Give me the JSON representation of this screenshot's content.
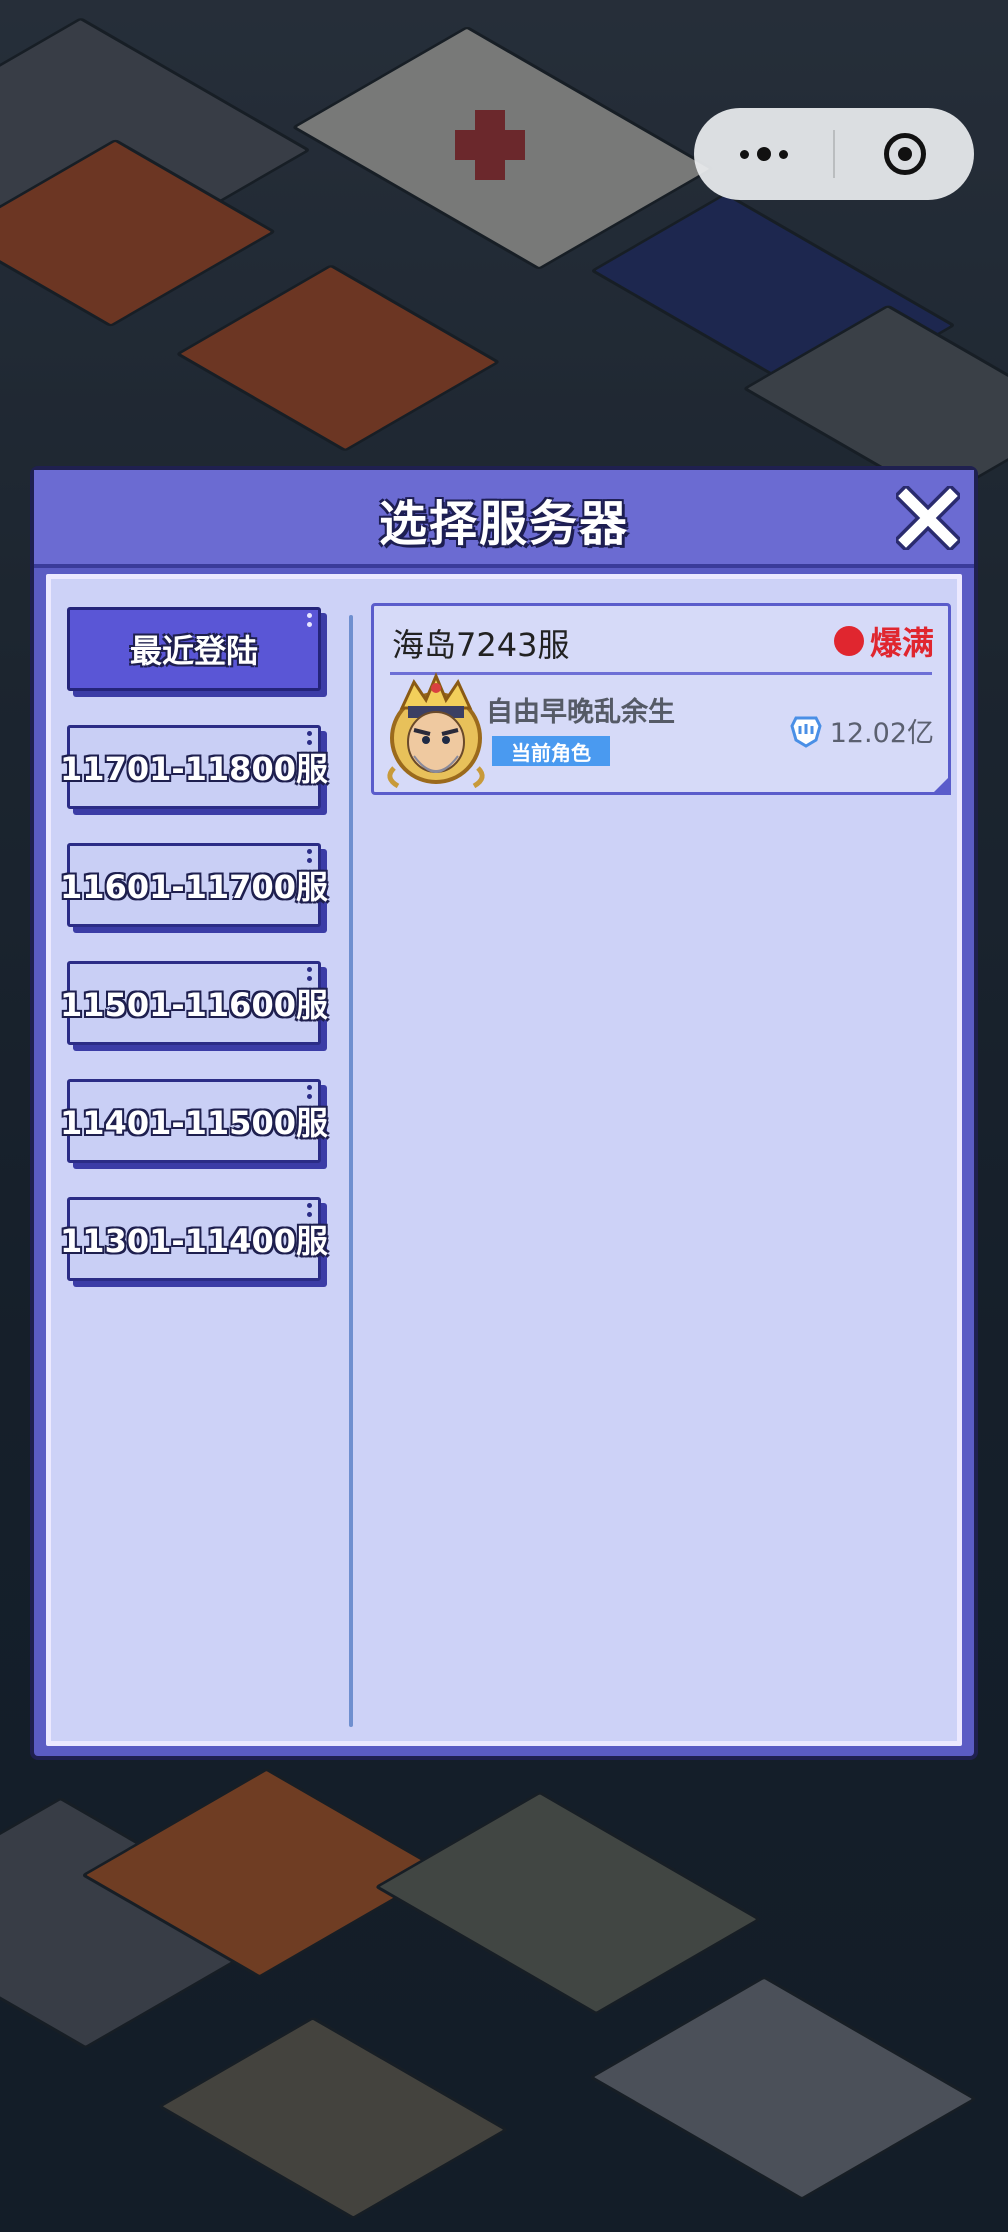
{
  "capsule": {
    "more_icon": "more-dots-icon",
    "close_icon": "target-ring-icon"
  },
  "dialog": {
    "title": "选择服务器",
    "close_icon": "close-x-icon"
  },
  "tabs": [
    {
      "label": "最近登陆",
      "active": true
    },
    {
      "label": "11701-11800服",
      "active": false
    },
    {
      "label": "11601-11700服",
      "active": false
    },
    {
      "label": "11501-11600服",
      "active": false
    },
    {
      "label": "11401-11500服",
      "active": false
    },
    {
      "label": "11301-11400服",
      "active": false
    }
  ],
  "server": {
    "name": "海岛7243服",
    "status": "爆满",
    "status_color": "#e0262f",
    "role_name": "自由早晚乱余生",
    "role_badge": "当前角色",
    "power": "12.02亿",
    "avatar_icon": "crowned-pirate-avatar",
    "power_icon": "fist-power-icon"
  },
  "colors": {
    "dialog_frame": "#5b5cc4",
    "panel_bg": "#cdd2f7",
    "tab_active": "#5a56d6",
    "badge": "#4a9af0"
  }
}
